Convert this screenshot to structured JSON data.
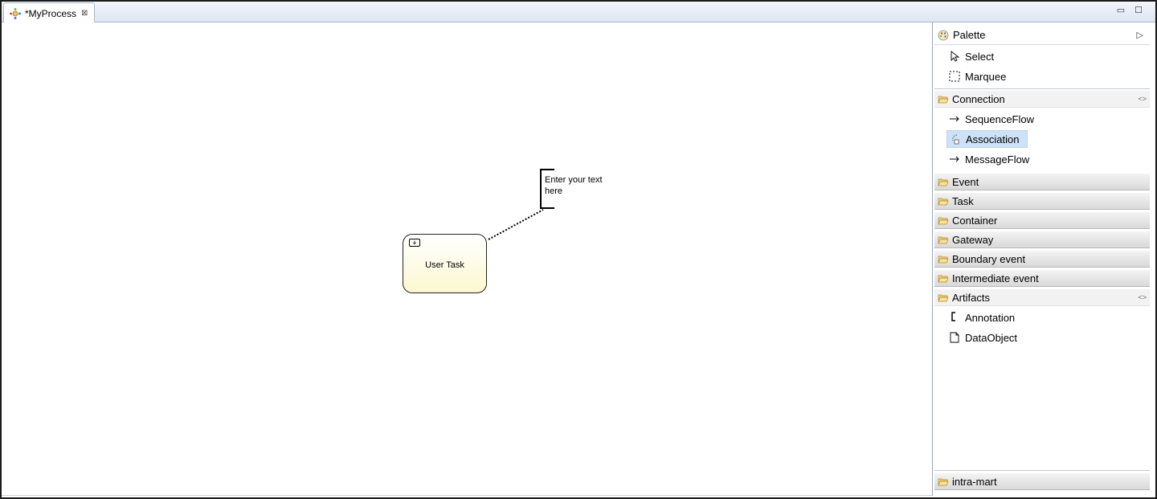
{
  "editor": {
    "tab_title": "*MyProcess",
    "close_glyph": "⊠",
    "minimize_glyph": "▭",
    "maximize_glyph": "☐"
  },
  "diagram": {
    "task_label": "User Task",
    "annotation_text": "Enter your text here"
  },
  "palette": {
    "title": "Palette",
    "collapse_glyph": "▷",
    "pin_glyph": "<>",
    "tools": [
      {
        "label": "Select",
        "icon": "arrow-cursor-icon"
      },
      {
        "label": "Marquee",
        "icon": "dashed-rect-icon"
      }
    ],
    "drawers": {
      "connection": {
        "label": "Connection",
        "items": [
          {
            "label": "SequenceFlow",
            "icon": "arrow-right-icon"
          },
          {
            "label": "Association",
            "icon": "association-icon",
            "selected": true
          },
          {
            "label": "MessageFlow",
            "icon": "arrow-right-icon"
          }
        ]
      },
      "event": {
        "label": "Event"
      },
      "task": {
        "label": "Task"
      },
      "container": {
        "label": "Container"
      },
      "gateway": {
        "label": "Gateway"
      },
      "boundary_event": {
        "label": "Boundary event"
      },
      "intermediate_event": {
        "label": "Intermediate event"
      },
      "artifacts": {
        "label": "Artifacts",
        "items": [
          {
            "label": "Annotation",
            "icon": "bracket-icon"
          },
          {
            "label": "DataObject",
            "icon": "document-icon"
          }
        ]
      },
      "intra_mart": {
        "label": "intra-mart"
      }
    }
  },
  "colors": {
    "selection": "#cde1f7",
    "task_fill": "#fbf8cf"
  }
}
